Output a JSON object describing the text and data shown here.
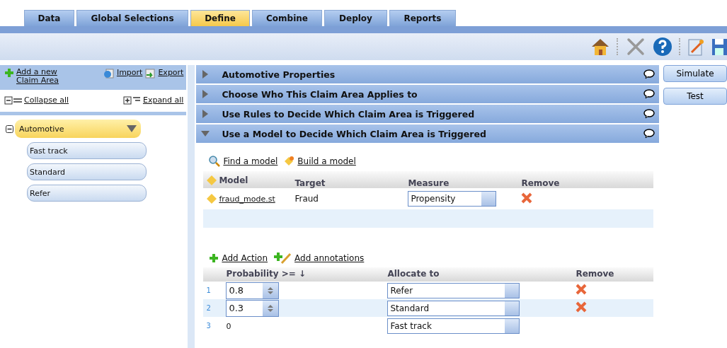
{
  "tabs": [
    {
      "label": "Data",
      "selected": false
    },
    {
      "label": "Global Selections",
      "selected": false
    },
    {
      "label": "Define",
      "selected": true
    },
    {
      "label": "Combine",
      "selected": false
    },
    {
      "label": "Deploy",
      "selected": false
    },
    {
      "label": "Reports",
      "selected": false
    }
  ],
  "sidebar": {
    "add_link": "Add a new Claim Area",
    "import_link": "Import",
    "export_link": "Export",
    "collapse_link": "Collapse all",
    "expand_link": "Expand all",
    "tree": [
      {
        "label": "Automotive",
        "selected": true,
        "expanded": true,
        "children": [
          {
            "label": "Fast track",
            "selected": false
          },
          {
            "label": "Standard",
            "selected": false
          },
          {
            "label": "Refer",
            "selected": false
          }
        ]
      }
    ]
  },
  "sections": [
    {
      "title": "Automotive Properties",
      "expanded": false
    },
    {
      "title": "Choose Who This Claim Area Applies to",
      "expanded": false
    },
    {
      "title": "Use Rules to Decide Which Claim Area is Triggered",
      "expanded": false
    },
    {
      "title": "Use a Model to Decide Which Claim Area is Triggered",
      "expanded": true
    }
  ],
  "side_buttons": [
    "Simulate",
    "Test"
  ],
  "model_links": {
    "find": "Find a model",
    "build": "Build a model"
  },
  "model_table": {
    "columns": [
      "Model",
      "Target",
      "Measure",
      "Remove"
    ],
    "rows": [
      {
        "model": "fraud_mode.st",
        "target": "Fraud",
        "measure": "Propensity"
      }
    ]
  },
  "action_links": {
    "add_action": "Add Action",
    "add_annotations": "Add annotations"
  },
  "action_table": {
    "columns": [
      "Probability >= ↓",
      "Allocate to",
      "Remove"
    ],
    "rows": [
      {
        "index": "1",
        "kind": "spinner",
        "probability": "0.8",
        "allocate": "Refer",
        "removable": true
      },
      {
        "index": "2",
        "kind": "spinner",
        "probability": "0.3",
        "allocate": "Standard",
        "removable": true
      },
      {
        "index": "3",
        "kind": "text",
        "probability": "0",
        "allocate": "Fast track",
        "removable": false
      }
    ]
  }
}
